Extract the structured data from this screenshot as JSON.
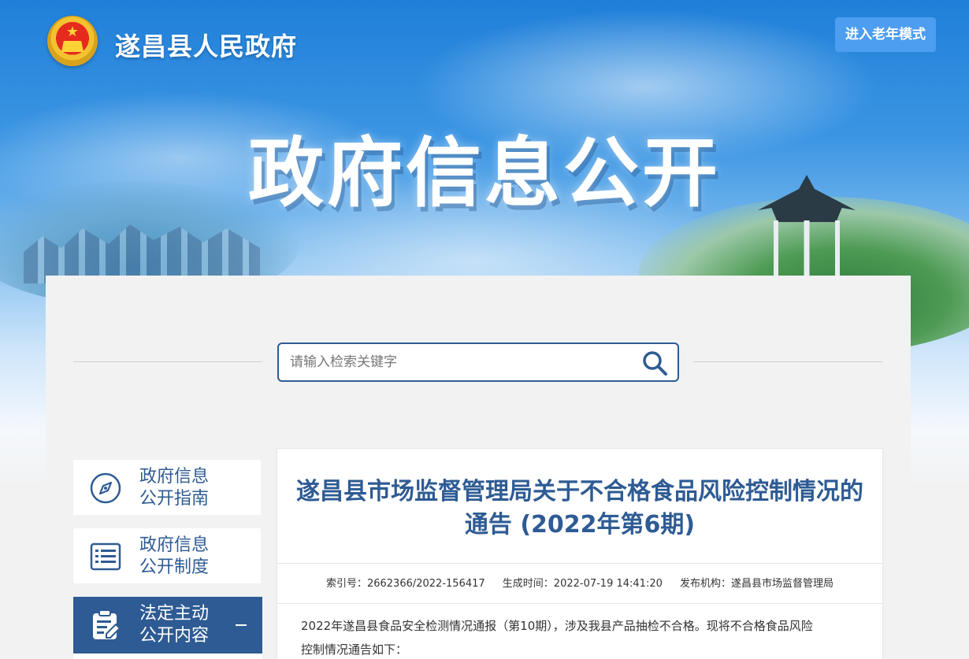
{
  "header": {
    "site_name": "遂昌县人民政府",
    "elder_mode_label": "进入老年模式",
    "hero_title": "政府信息公开"
  },
  "search": {
    "placeholder": "请输入检索关键字"
  },
  "sidebar": {
    "items": [
      {
        "label_line1": "政府信息",
        "label_line2": "公开指南",
        "icon": "compass-icon"
      },
      {
        "label_line1": "政府信息",
        "label_line2": "公开制度",
        "icon": "list-icon"
      },
      {
        "label_line1": "法定主动",
        "label_line2": "公开内容",
        "icon": "clipboard-edit-icon",
        "active": true
      }
    ]
  },
  "article": {
    "title": "遂昌县市场监督管理局关于不合格食品风险控制情况的通告 (2022年第6期)",
    "meta": {
      "index_no": "索引号：2662366/2022-156417",
      "created": "生成时间：2022-07-19 14:41:20",
      "publisher": "发布机构：遂昌县市场监督管理局"
    },
    "body_line1": "2022年遂昌县食品安全检测情况通报（第10期），涉及我县产品抽检不合格。现将不合格食品风险",
    "body_line2": "控制情况通告如下："
  },
  "colors": {
    "brand_blue": "#2e5b93",
    "elder_button": "#4d9df0",
    "page_bg": "#f2f2f2"
  }
}
